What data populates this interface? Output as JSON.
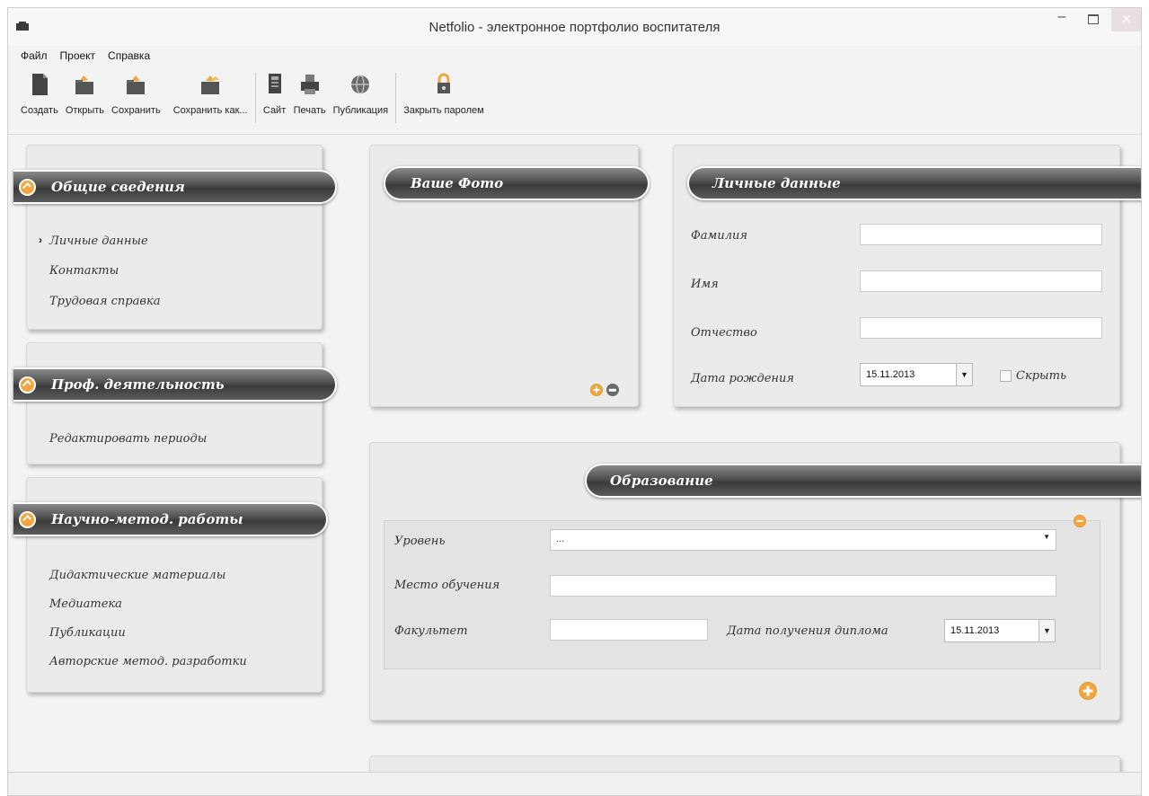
{
  "window": {
    "title": "Netfolio - электронное портфолио воспитателя",
    "min_symbol": "–",
    "close_symbol": "✕"
  },
  "menu": [
    "Файл",
    "Проект",
    "Справка"
  ],
  "toolbar": {
    "create": "Создать",
    "open": "Открыть",
    "save": "Сохранить",
    "save_as": "Сохранить как...",
    "site": "Сайт",
    "print": "Печать",
    "publish": "Публикация",
    "lock": "Закрыть паролем"
  },
  "sidebar": {
    "general": {
      "title": "Общие сведения",
      "items": [
        "Личные данные",
        "Контакты",
        "Трудовая справка"
      ],
      "active_marker": "›"
    },
    "prof": {
      "title": "Проф. деятельность",
      "items": [
        "Редактировать периоды"
      ]
    },
    "science": {
      "title": "Научно-метод. работы",
      "items": [
        "Дидактические материалы",
        "Медиатека",
        "Публикации",
        "Авторские метод. разработки"
      ]
    }
  },
  "photo": {
    "title": "Ваше Фото"
  },
  "personal": {
    "title": "Личные данные",
    "surname_label": "Фамилия",
    "surname_value": "",
    "name_label": "Имя",
    "name_value": "",
    "patronymic_label": "Отчество",
    "patronymic_value": "",
    "birth_label": "Дата рождения",
    "birth_value": "15.11.2013",
    "hide_label": "Скрыть",
    "hide_checked": false
  },
  "education": {
    "title": "Образование",
    "level_label": "Уровень",
    "level_value": "...",
    "place_label": "Место обучения",
    "place_value": "",
    "faculty_label": "Факультет",
    "faculty_value": "",
    "diploma_label": "Дата получения диплома",
    "diploma_value": "15.11.2013"
  },
  "colors": {
    "accent": "#f3a640",
    "ribbon": "#4e4e4e",
    "panel": "#ebebeb"
  }
}
